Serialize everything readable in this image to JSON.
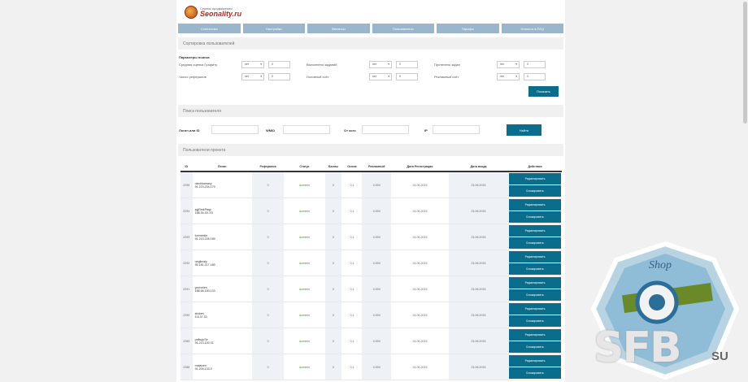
{
  "site": {
    "tagline": "Сервис продвижения",
    "name": "Seonality.ru"
  },
  "nav": [
    {
      "label": "Статистика"
    },
    {
      "label": "Настройки"
    },
    {
      "label": "Финансы"
    },
    {
      "label": "Пользователи"
    },
    {
      "label": "Тарифы"
    },
    {
      "label": "Новости & FAQ"
    }
  ],
  "filters": {
    "section_title": "Сортировка пользователей",
    "params_label": "Параметры поиска",
    "items": [
      {
        "label": "Средняя оценка Графиту",
        "op": "нет",
        "value": "0"
      },
      {
        "label": "Выполнено заданий",
        "op": "нет",
        "value": "0"
      },
      {
        "label": "Протенено задач",
        "op": "нет",
        "value": "0"
      },
      {
        "label": "Число рефералов",
        "op": "нет",
        "value": "0"
      },
      {
        "label": "Основной счёт",
        "op": "нет",
        "value": "0"
      },
      {
        "label": "Рекламный счёт",
        "op": "нет",
        "value": "0"
      }
    ],
    "apply_label": "Показать"
  },
  "search": {
    "section_title": "Поиск пользователя",
    "login_label": "Логин или ID",
    "wmid_label": "WMID",
    "ref_label": "От кого",
    "ip_label": "IP",
    "button_label": "Найти"
  },
  "users": {
    "section_title": "Пользователи проекта",
    "columns": [
      "ID",
      "Логин",
      "Рефералов",
      "Статус",
      "Баллы",
      "Основ",
      "Рекламный",
      "Дата Регистрации",
      "Дата входа",
      "Действия"
    ],
    "rows": [
      {
        "id": "2295",
        "login": "olechkamaxy",
        "ip": "91.223.234.179",
        "refs": "0",
        "status": "Активен",
        "points": "0",
        "main": "0.1",
        "ad": "0.000",
        "reg": "24.06.2015",
        "last": "24.06.2015"
      },
      {
        "id": "2294",
        "login": "zgjRmkPaqy",
        "ip": "188.34.XX.XX",
        "refs": "0",
        "status": "Активен",
        "points": "0",
        "main": "0.1",
        "ad": "0.000",
        "reg": "24.06.2015",
        "last": "24.06.2015"
      },
      {
        "id": "2293",
        "login": "turmankin",
        "ip": "91.213.228.189",
        "refs": "0",
        "status": "Активен",
        "points": "0",
        "main": "0.1",
        "ad": "0.000",
        "reg": "24.06.2015",
        "last": "24.06.2015"
      },
      {
        "id": "2292",
        "login": "negiknaiy",
        "ip": "95.181.217.189",
        "refs": "0",
        "status": "Активен",
        "points": "0",
        "main": "0.1",
        "ad": "0.000",
        "reg": "24.06.2015",
        "last": "24.06.2015"
      },
      {
        "id": "2291",
        "login": "youivelen",
        "ip": "188.68.150.133",
        "refs": "0",
        "status": "Активен",
        "points": "0",
        "main": "0.1",
        "ad": "0.000",
        "reg": "24.06.2015",
        "last": "24.06.2015"
      },
      {
        "id": "2290",
        "login": "shobev",
        "ip": "5.8.37.33",
        "refs": "0",
        "status": "Активен",
        "points": "0",
        "main": "0.1",
        "ad": "0.000",
        "reg": "24.06.2015",
        "last": "24.06.2015"
      },
      {
        "id": "2289",
        "login": "pafkujuSe",
        "ip": "91.213.100.31",
        "refs": "0",
        "status": "Активен",
        "points": "0",
        "main": "0.1",
        "ad": "0.000",
        "reg": "24.06.2015",
        "last": "24.06.2015"
      },
      {
        "id": "2288",
        "login": "malaizen",
        "ip": "91.205.133.9",
        "refs": "0",
        "status": "Активен",
        "points": "0",
        "main": "0.1",
        "ad": "0.000",
        "reg": "24.06.2015",
        "last": "24.06.2015"
      }
    ],
    "edit_label": "Редактировать",
    "block_label": "Блокировать"
  },
  "watermark": {
    "shop": "Shop",
    "brand": "SFB",
    "suffix": "SU"
  },
  "colors": {
    "nav": "#9ab6cf",
    "button": "#0a6d8c",
    "status_active": "#4c9a34",
    "brand": "#c0261d"
  }
}
